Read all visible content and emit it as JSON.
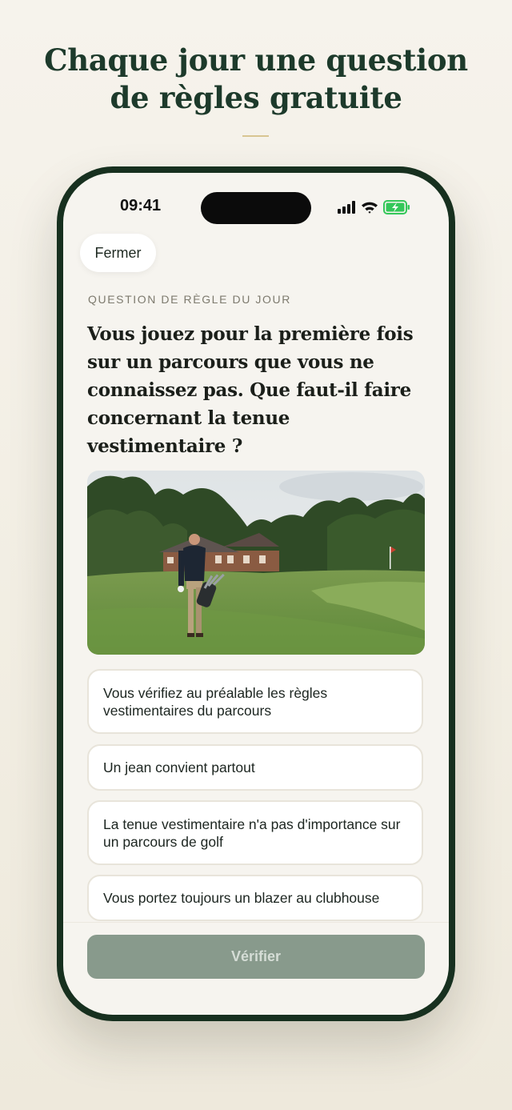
{
  "promo": {
    "headline_line1": "Chaque jour une question",
    "headline_line2": "de règles gratuite"
  },
  "status_bar": {
    "time": "09:41"
  },
  "toolbar": {
    "close_label": "Fermer"
  },
  "quiz": {
    "eyebrow": "QUESTION DE RÈGLE DU JOUR",
    "question": "Vous jouez pour la première fois sur un parcours que vous ne connaissez pas. Que faut-il faire concernant la tenue vestimentaire ?",
    "options": [
      "Vous vérifiez au préalable les règles vestimentaires du parcours",
      "Un jean convient partout",
      "La tenue vestimentaire n'a pas d'importance sur un parcours de golf",
      "Vous portez toujours un blazer au clubhouse"
    ],
    "verify_label": "Vérifier"
  },
  "colors": {
    "brand_green": "#1d3a2b",
    "accent_gold": "#d8c592",
    "disabled_button": "#889a8c"
  },
  "icons": [
    "signal-icon",
    "wifi-icon",
    "battery-charging-icon"
  ]
}
